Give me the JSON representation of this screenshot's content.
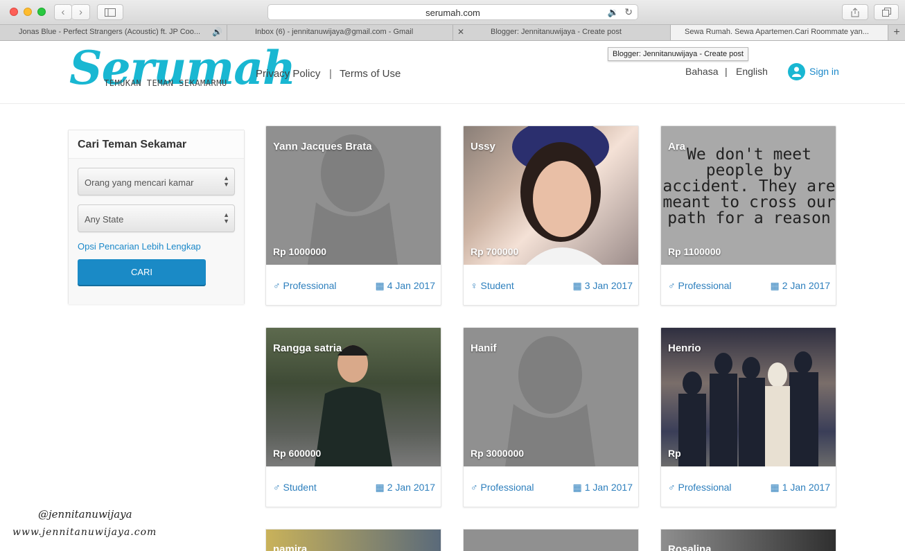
{
  "browser": {
    "url": "serumah.com",
    "tabs": [
      {
        "label": "Jonas Blue - Perfect Strangers (Acoustic) ft. JP Coo..."
      },
      {
        "label": "Inbox (6) - jennitanuwijaya@gmail.com - Gmail"
      },
      {
        "label": "Blogger: Jennitanuwijaya - Create post"
      },
      {
        "label": "Sewa Rumah. Sewa Apartemen.Cari Roommate yan..."
      }
    ],
    "tooltip": "Blogger: Jennitanuwijaya - Create post"
  },
  "header": {
    "logo_title": "Serumah",
    "logo_tagline": "TEMUKAN TEMAN SEKAMARMU",
    "nav": {
      "privacy": "Privacy Policy",
      "separator": "|",
      "terms": "Terms of Use"
    },
    "lang": {
      "bahasa": "Bahasa",
      "separator": "|",
      "english": "English"
    },
    "signin": "Sign in"
  },
  "sidebar": {
    "title": "Cari Teman Sekamar",
    "select_type": "Orang yang mencari kamar",
    "select_state": "Any State",
    "more_options": "Opsi Pencarian Lebih Lengkap",
    "search_button": "CARI"
  },
  "cards": [
    {
      "name": "Yann Jacques Brata",
      "price": "Rp 1000000",
      "role": "Professional",
      "date": "4 Jan 2017",
      "gender": "male"
    },
    {
      "name": "Ussy",
      "price": "Rp 700000",
      "role": "Student",
      "date": "3 Jan 2017",
      "gender": "female"
    },
    {
      "name": "Ara",
      "price": "Rp 1100000",
      "role": "Professional",
      "date": "2 Jan 2017",
      "gender": "male",
      "quote": "We don't meet people by accident. They are meant to cross our path for a reason"
    },
    {
      "name": "Rangga satria",
      "price": "Rp 600000",
      "role": "Student",
      "date": "2 Jan 2017",
      "gender": "male"
    },
    {
      "name": "Hanif",
      "price": "Rp 3000000",
      "role": "Professional",
      "date": "1 Jan 2017",
      "gender": "male"
    },
    {
      "name": "Henrio",
      "price": "Rp",
      "role": "Professional",
      "date": "1 Jan 2017",
      "gender": "male"
    }
  ],
  "peek_cards": [
    {
      "name": "namira"
    },
    {
      "name": ""
    },
    {
      "name": "Rosalina"
    }
  ],
  "watermark": {
    "handle": "@jennitanuwijaya",
    "site": "www.jennitanuwijaya.com"
  },
  "colors": {
    "brand": "#19b7d2",
    "link": "#1a88c9",
    "button": "#1a8ac6"
  },
  "icons": {
    "male": "male-symbol-icon",
    "female": "female-symbol-icon",
    "calendar": "calendar-icon"
  }
}
